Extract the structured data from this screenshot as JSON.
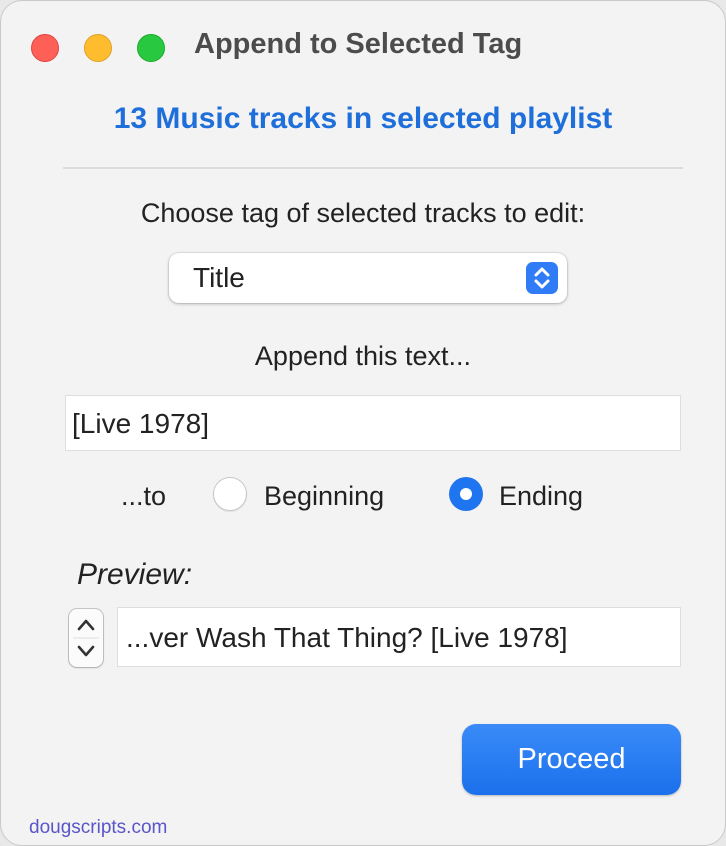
{
  "window": {
    "title": "Append to Selected Tag"
  },
  "header": {
    "count_text": "13 Music tracks in selected playlist"
  },
  "tag_section": {
    "label": "Choose tag of selected tracks to edit:",
    "selected_tag": "Title"
  },
  "append_section": {
    "label": "Append this text...",
    "text_value": "[Live 1978]"
  },
  "position": {
    "to_label": "...to",
    "options": [
      "Beginning",
      "Ending"
    ],
    "selected": "Ending"
  },
  "preview": {
    "label": "Preview:",
    "value": "...ver Wash That Thing? [Live 1978]"
  },
  "actions": {
    "proceed_label": "Proceed"
  },
  "footer": {
    "link_text": "dougscripts.com"
  },
  "colors": {
    "accent": "#1f74ef",
    "count_text": "#1f6fdb",
    "close": "#fe5f57",
    "minimize": "#febc2e",
    "zoom": "#28c840",
    "footer_link": "#5a55c8"
  },
  "icons": {
    "popup_arrows": "chevron-up-down-icon",
    "stepper": "stepper-arrows-icon"
  }
}
